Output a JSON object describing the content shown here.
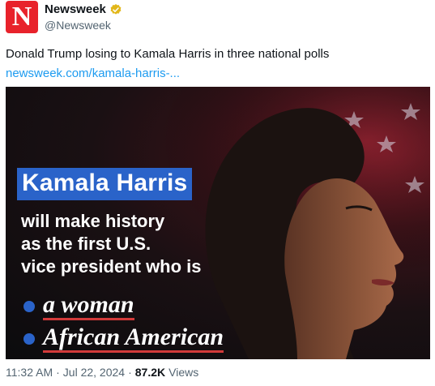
{
  "account": {
    "avatar_letter": "N",
    "name": "Newsweek",
    "handle": "@Newsweek",
    "verified_color": "#e2b719"
  },
  "tweet": {
    "text": "Donald Trump losing to Kamala Harris in three national polls",
    "link_text": "newsweek.com/kamala-harris-..."
  },
  "media": {
    "headline": "Kamala Harris",
    "lines": [
      "will make history",
      "as the first U.S.",
      "vice president who is"
    ],
    "bullets": [
      "a woman",
      "African American"
    ]
  },
  "meta": {
    "time": "11:32 AM",
    "separator": "·",
    "date": "Jul 22, 2024",
    "views_count": "87.2K",
    "views_label": "Views"
  },
  "colors": {
    "accent_blue": "#2a63c9",
    "link_blue": "#1d9bf0",
    "brand_red": "#e8222b",
    "underline_red": "#d23a3a"
  }
}
